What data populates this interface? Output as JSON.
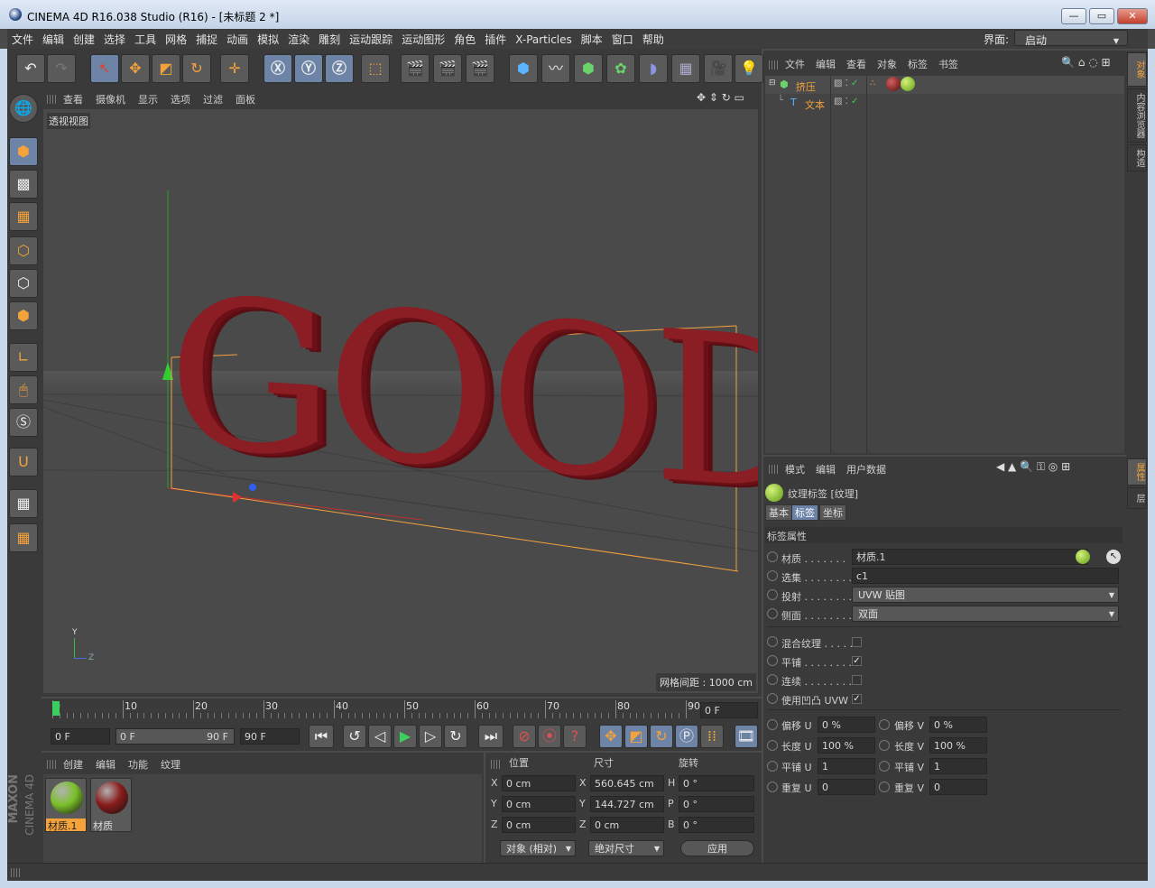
{
  "window": {
    "title": "CINEMA 4D R16.038 Studio (R16) - [未标题 2 *]",
    "minimize": "—",
    "maximize": "▭",
    "close": "✕"
  },
  "menu": {
    "items": [
      "文件",
      "编辑",
      "创建",
      "选择",
      "工具",
      "网格",
      "捕捉",
      "动画",
      "模拟",
      "渲染",
      "雕刻",
      "运动跟踪",
      "运动图形",
      "角色",
      "插件",
      "X-Particles",
      "脚本",
      "窗口",
      "帮助"
    ],
    "layout_label": "界面:",
    "layout_value": "启动"
  },
  "viewport": {
    "menu": [
      "查看",
      "摄像机",
      "显示",
      "选项",
      "过滤",
      "面板"
    ],
    "view_name": "透视视图",
    "grid_spacing": "网格间距 : 1000 cm",
    "scene_text": "GOOD",
    "axis_y": "Y",
    "axis_z": "Z"
  },
  "timeline": {
    "ticks": [
      "0",
      "10",
      "20",
      "30",
      "40",
      "50",
      "60",
      "70",
      "80",
      "90"
    ],
    "current_frame": "0 F",
    "start_field": "0 F",
    "range_start": "0 F",
    "range_end": "90 F",
    "end_field": "90 F"
  },
  "objects": {
    "menu": [
      "文件",
      "编辑",
      "查看",
      "对象",
      "标签",
      "书签"
    ],
    "items": [
      {
        "name": "挤压"
      },
      {
        "name": "文本"
      }
    ]
  },
  "attributes": {
    "menu": [
      "模式",
      "编辑",
      "用户数据"
    ],
    "header": "纹理标签 [纹理]",
    "tabs": [
      "基本",
      "标签",
      "坐标"
    ],
    "section": "标签属性",
    "rows": [
      {
        "label": "材质 . . . . . . .",
        "value": "材质.1"
      },
      {
        "label": "选集 . . . . . . . .",
        "value": "c1"
      },
      {
        "label": "投射 . . . . . . . .",
        "value": "UVW 贴图"
      },
      {
        "label": "侧面 . . . . . . . .",
        "value": "双面"
      }
    ],
    "checks": [
      {
        "label": "混合纹理 . . . . .",
        "checked": ""
      },
      {
        "label": "平铺 . . . . . . . .",
        "checked": "✓"
      },
      {
        "label": "连续 . . . . . . . .",
        "checked": ""
      },
      {
        "label": "使用凹凸 UVW",
        "checked": "✓"
      }
    ],
    "uv": [
      {
        "l_label": "偏移 U",
        "l_value": "0 %",
        "r_label": "偏移 V",
        "r_value": "0 %"
      },
      {
        "l_label": "长度 U",
        "l_value": "100 %",
        "r_label": "长度 V",
        "r_value": "100 %"
      },
      {
        "l_label": "平铺 U",
        "l_value": "1",
        "r_label": "平铺 V",
        "r_value": "1"
      },
      {
        "l_label": "重复 U",
        "l_value": "0",
        "r_label": "重复 V",
        "r_value": "0"
      }
    ]
  },
  "materials": {
    "menu": [
      "创建",
      "编辑",
      "功能",
      "纹理"
    ],
    "items": [
      {
        "name": "材质.1",
        "color": "#7bc02a"
      },
      {
        "name": "材质",
        "color": "#8a1c1c"
      }
    ]
  },
  "coordinates": {
    "headers": [
      "位置",
      "尺寸",
      "旋转"
    ],
    "rows": [
      {
        "axis": "X",
        "pos": "0 cm",
        "saxis": "X",
        "size": "560.645 cm",
        "raxis": "H",
        "rot": "0 °"
      },
      {
        "axis": "Y",
        "pos": "0 cm",
        "saxis": "Y",
        "size": "144.727 cm",
        "raxis": "P",
        "rot": "0 °"
      },
      {
        "axis": "Z",
        "pos": "0 cm",
        "saxis": "Z",
        "size": "0 cm",
        "raxis": "B",
        "rot": "0 °"
      }
    ],
    "mode": "对象 (相对)",
    "size_mode": "绝对尺寸",
    "apply": "应用"
  },
  "side_tabs": {
    "right_top": [
      "对象",
      "内容浏览器",
      "构造"
    ],
    "right_bottom": [
      "属性",
      "层"
    ]
  },
  "brand": {
    "maxon": "MAXON",
    "c4d": "CINEMA 4D"
  }
}
